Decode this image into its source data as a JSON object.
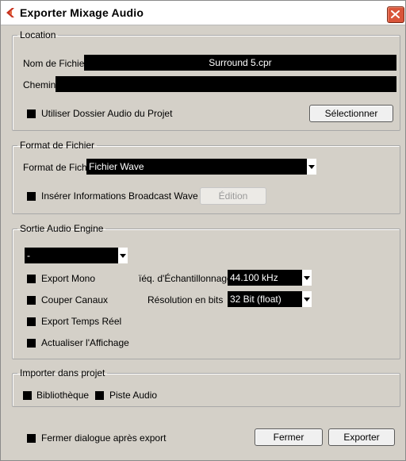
{
  "window": {
    "title": "Exporter Mixage Audio",
    "icon": "steinberg-logo",
    "close_icon": "close-icon"
  },
  "location": {
    "legend": "Location",
    "filename_label": "Nom de Fichier",
    "filename_value": "Surround 5.cpr",
    "path_label": "Chemin",
    "path_value": "",
    "use_project_folder_label": "Utiliser Dossier Audio du Projet",
    "select_button": "Sélectionner"
  },
  "file_format": {
    "legend": "Format de Fichier",
    "format_label": "Format de Fichier",
    "format_value": "Fichier Wave",
    "broadcast_label": "Insérer Informations Broadcast Wave",
    "edit_button": "Édition"
  },
  "audio_engine": {
    "legend": "Sortie Audio Engine",
    "output_value": "-",
    "export_mono": "Export Mono",
    "split_channels": "Couper Canaux",
    "realtime_export": "Export Temps Réel",
    "update_display": "Actualiser l'Affichage",
    "sample_rate_label": "ïéq. d'Échantillonnage",
    "sample_rate_value": "44.100 kHz",
    "bit_depth_label": "Résolution en bits",
    "bit_depth_value": "32 Bit (float)"
  },
  "import": {
    "legend": "Importer dans projet",
    "library": "Bibliothèque",
    "audio_track": "Piste Audio"
  },
  "footer": {
    "close_after_export": "Fermer dialogue après export",
    "close_button": "Fermer",
    "export_button": "Exporter"
  },
  "colors": {
    "dialog_bg": "#d4d0c8",
    "field_bg": "#000000",
    "field_text": "#ffffff",
    "close_button": "#d9553a",
    "logo": "#c8321e"
  }
}
